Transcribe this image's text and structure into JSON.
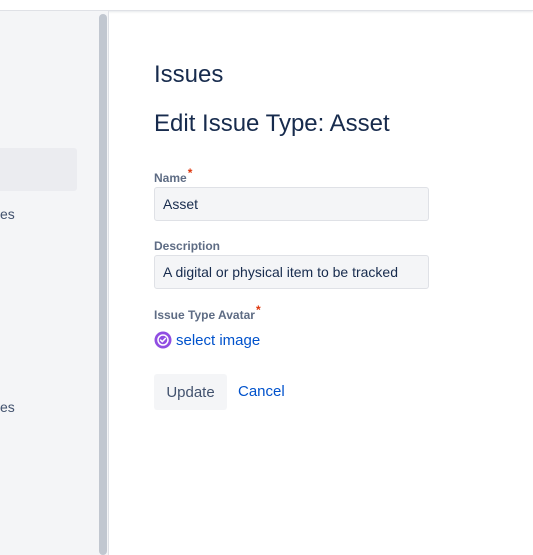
{
  "sidebar": {
    "item_partial_1": "es",
    "item_partial_2": "es"
  },
  "page": {
    "title": "Issues",
    "form_title": "Edit Issue Type: Asset"
  },
  "form": {
    "name": {
      "label": "Name",
      "required_mark": "*",
      "value": "Asset"
    },
    "description": {
      "label": "Description",
      "value": "A digital or physical item to be tracked"
    },
    "avatar": {
      "label": "Issue Type Avatar",
      "required_mark": "*",
      "link_label": "select image",
      "icon": "asset-issue-type-icon",
      "icon_color": "#904ee2"
    },
    "update_label": "Update",
    "cancel_label": "Cancel"
  },
  "colors": {
    "link": "#0052cc",
    "required": "#de350b"
  }
}
